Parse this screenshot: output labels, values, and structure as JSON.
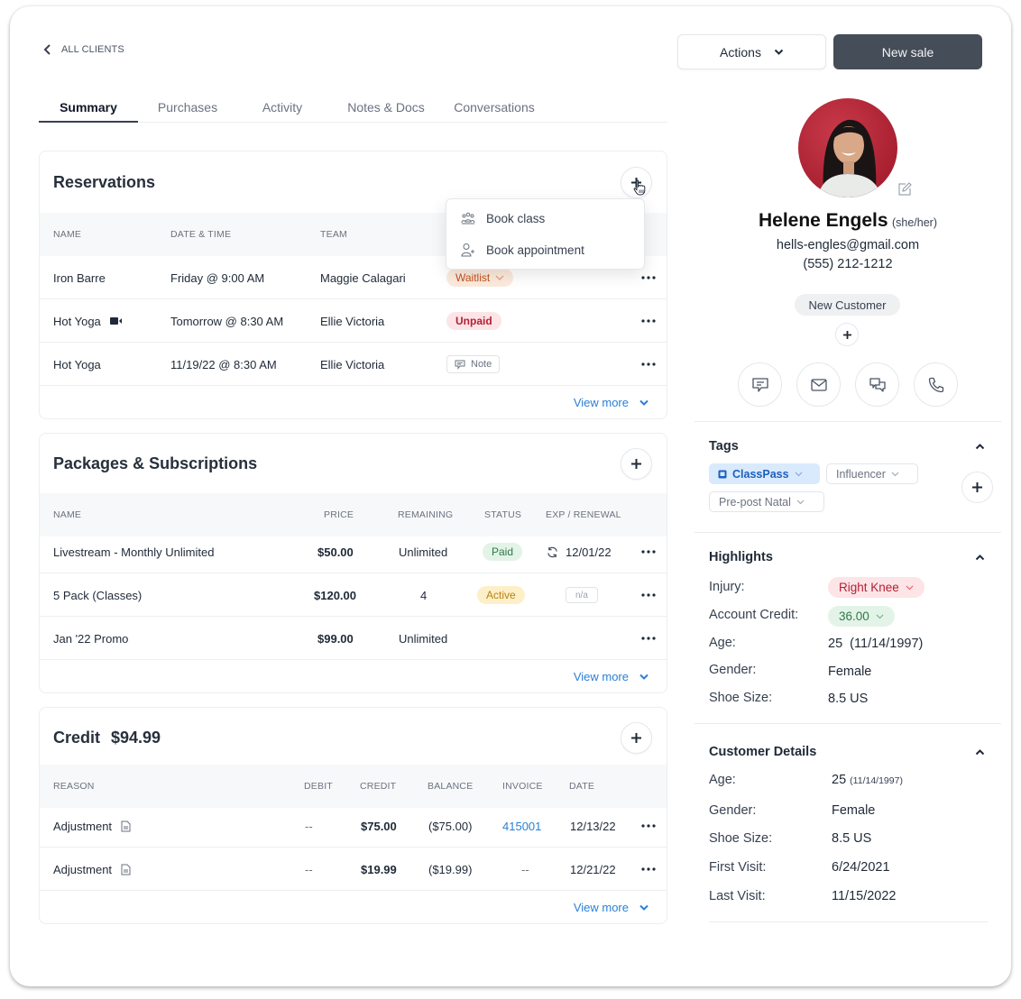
{
  "nav": {
    "back_label": "ALL CLIENTS"
  },
  "tabs": [
    {
      "label": "Summary",
      "active": true
    },
    {
      "label": "Purchases",
      "active": false
    },
    {
      "label": "Activity",
      "active": false
    },
    {
      "label": "Notes & Docs",
      "active": false
    },
    {
      "label": "Conversations",
      "active": false
    }
  ],
  "header": {
    "actions_label": "Actions",
    "new_sale_label": "New sale"
  },
  "reservations": {
    "title": "Reservations",
    "columns": [
      "NAME",
      "DATE & TIME",
      "TEAM"
    ],
    "rows": [
      {
        "name": "Iron Barre",
        "datetime": "Friday @ 9:00 AM",
        "team": "Maggie Calagari",
        "status": "Waitlist",
        "status_type": "waitlist",
        "video": false
      },
      {
        "name": "Hot Yoga",
        "datetime": "Tomorrow @ 8:30 AM",
        "team": "Ellie Victoria",
        "status": "Unpaid",
        "status_type": "unpaid",
        "video": true
      },
      {
        "name": "Hot Yoga",
        "datetime": "11/19/22 @ 8:30 AM",
        "team": "Ellie Victoria",
        "status": "Note",
        "status_type": "note",
        "video": false
      }
    ],
    "view_more": "View more",
    "dropdown": [
      {
        "label": "Book class",
        "icon": "group-icon"
      },
      {
        "label": "Book appointment",
        "icon": "add-person-icon"
      }
    ]
  },
  "packages": {
    "title": "Packages & Subscriptions",
    "columns": [
      "NAME",
      "PRICE",
      "REMAINING",
      "STATUS",
      "EXP / RENEWAL"
    ],
    "rows": [
      {
        "name": "Livestream - Monthly Unlimited",
        "price": "$50.00",
        "remaining": "Unlimited",
        "status": "Paid",
        "status_type": "paid",
        "renewal": "12/01/22"
      },
      {
        "name": "5 Pack (Classes)",
        "price": "$120.00",
        "remaining": "4",
        "status": "Active",
        "status_type": "active",
        "renewal": "n/a"
      },
      {
        "name": "Jan '22 Promo",
        "price": "$99.00",
        "remaining": "Unlimited",
        "status": "",
        "status_type": "",
        "renewal": ""
      }
    ],
    "view_more": "View more"
  },
  "credit": {
    "title": "Credit",
    "amount": "$94.99",
    "columns": [
      "REASON",
      "DEBIT",
      "CREDIT",
      "BALANCE",
      "INVOICE",
      "DATE"
    ],
    "rows": [
      {
        "reason": "Adjustment",
        "debit": "--",
        "credit": "$75.00",
        "balance": "($75.00)",
        "invoice": "415001",
        "invoice_link": true,
        "date": "12/13/22"
      },
      {
        "reason": "Adjustment",
        "debit": "--",
        "credit": "$19.99",
        "balance": "($19.99)",
        "invoice": "--",
        "invoice_link": false,
        "date": "12/21/22"
      }
    ],
    "view_more": "View more"
  },
  "profile": {
    "name": "Helene Engels",
    "pronouns": "(she/her)",
    "email": "hells-engles@gmail.com",
    "phone": "(555) 212-1212",
    "customer_type": "New Customer",
    "contact_actions": [
      "sms-icon",
      "email-icon",
      "chat-icon",
      "phone-icon"
    ]
  },
  "tags": {
    "title": "Tags",
    "items": [
      {
        "label": "ClassPass",
        "style": "classpass"
      },
      {
        "label": "Influencer",
        "style": "plain"
      },
      {
        "label": "Pre-post Natal",
        "style": "plain"
      }
    ]
  },
  "highlights": {
    "title": "Highlights",
    "injury_label": "Injury:",
    "injury_value": "Right Knee",
    "credit_label": "Account Credit:",
    "credit_value": "36.00",
    "age_label": "Age:",
    "age_value": "25  (11/14/1997)",
    "gender_label": "Gender:",
    "gender_value": "Female",
    "shoe_label": "Shoe Size:",
    "shoe_value": "8.5 US"
  },
  "customer_details": {
    "title": "Customer Details",
    "age_label": "Age:",
    "age_value": "25",
    "age_dob": "(11/14/1997)",
    "gender_label": "Gender:",
    "gender_value": "Female",
    "shoe_label": "Shoe Size:",
    "shoe_value": "8.5 US",
    "first_visit_label": "First Visit:",
    "first_visit_value": "6/24/2021",
    "last_visit_label": "Last Visit:",
    "last_visit_value": "11/15/2022"
  },
  "colors": {
    "primary_button": "#454d58",
    "link": "#2b7fd6",
    "waitlist": "#c2501c",
    "unpaid": "#b51f34",
    "paid": "#2d7a48",
    "active": "#b98214",
    "classpass": "#1d5fbf"
  }
}
